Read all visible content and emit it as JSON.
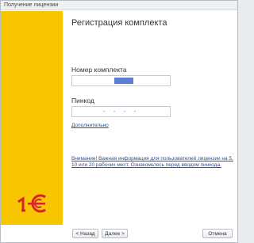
{
  "window": {
    "title": "Получение лицензии"
  },
  "form": {
    "heading": "Регистрация комплекта",
    "kit_label": "Номер комплекта",
    "kit_value": "",
    "pin_label": "Пинкод",
    "pin_value": "- - - -",
    "more_link": "Дополнительно",
    "notice_text": "Внимание! Важная информация для пользователей лицензии на 5, 10 или 20 рабочих мест. Ознакомьтесь перед вводом пинкода."
  },
  "footer": {
    "back_label": "< Назад",
    "next_label": "Далее >",
    "cancel_label": "Отмена"
  },
  "colors": {
    "sidebar": "#f7c600",
    "logo_red": "#d8232a",
    "link": "#2a4f9a",
    "mask": "#5b7fd1"
  },
  "icons": {
    "logo": "1c-logo-icon"
  }
}
